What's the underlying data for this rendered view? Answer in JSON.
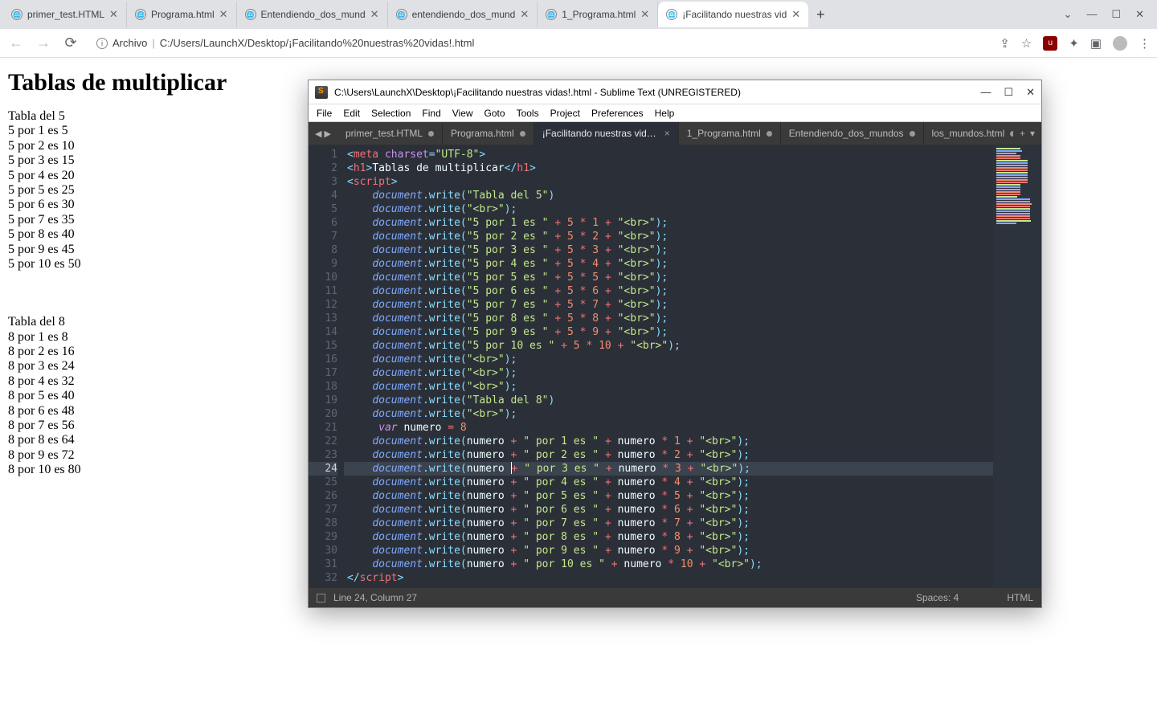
{
  "browser": {
    "tabs": [
      {
        "label": "primer_test.HTML"
      },
      {
        "label": "Programa.html"
      },
      {
        "label": "Entendiendo_dos_mund"
      },
      {
        "label": "entendiendo_dos_mund"
      },
      {
        "label": "1_Programa.html"
      },
      {
        "label": "¡Facilitando nuestras vid"
      }
    ],
    "active_tab": 5,
    "url_prefix": "Archivo",
    "url": "C:/Users/LaunchX/Desktop/¡Facilitando%20nuestras%20vidas!.html"
  },
  "page": {
    "h1": "Tablas de multiplicar",
    "block1_title": "Tabla del 5",
    "block1": [
      "5 por 1 es 5",
      "5 por 2 es 10",
      "5 por 3 es 15",
      "5 por 4 es 20",
      "5 por 5 es 25",
      "5 por 6 es 30",
      "5 por 7 es 35",
      "5 por 8 es 40",
      "5 por 9 es 45",
      "5 por 10 es 50"
    ],
    "block2_title": "Tabla del 8",
    "block2": [
      "8 por 1 es 8",
      "8 por 2 es 16",
      "8 por 3 es 24",
      "8 por 4 es 32",
      "8 por 5 es 40",
      "8 por 6 es 48",
      "8 por 7 es 56",
      "8 por 8 es 64",
      "8 por 9 es 72",
      "8 por 10 es 80"
    ]
  },
  "sublime": {
    "title": "C:\\Users\\LaunchX\\Desktop\\¡Facilitando nuestras vidas!.html - Sublime Text (UNREGISTERED)",
    "menus": [
      "File",
      "Edit",
      "Selection",
      "Find",
      "View",
      "Goto",
      "Tools",
      "Project",
      "Preferences",
      "Help"
    ],
    "tabs": [
      {
        "label": "primer_test.HTML",
        "dirty": true
      },
      {
        "label": "Programa.html",
        "dirty": true
      },
      {
        "label": "¡Facilitando nuestras vidas!.html",
        "dirty": false,
        "active": true
      },
      {
        "label": "1_Programa.html",
        "dirty": true
      },
      {
        "label": "Entendiendo_dos_mundos",
        "dirty": true
      },
      {
        "label": "los_mundos.html",
        "dirty": true
      }
    ],
    "status_left": "Line 24, Column 27",
    "status_spaces": "Spaces: 4",
    "status_lang": "HTML",
    "highlight_line": 24,
    "code": [
      {
        "n": 1,
        "html": "<span class='c-punc'>&lt;</span><span class='c-tag'>meta</span> <span class='c-attr'>charset</span><span class='c-punc'>=</span><span class='c-str'>\"UTF-8\"</span><span class='c-punc'>&gt;</span>"
      },
      {
        "n": 2,
        "html": "<span class='c-punc'>&lt;</span><span class='c-tag'>h1</span><span class='c-punc'>&gt;</span><span class='c-text'>Tablas de multiplicar</span><span class='c-punc'>&lt;/</span><span class='c-tag'>h1</span><span class='c-punc'>&gt;</span>"
      },
      {
        "n": 3,
        "html": "<span class='c-punc'>&lt;</span><span class='c-tag'>script</span><span class='c-punc'>&gt;</span>"
      },
      {
        "n": 4,
        "html": "    <span class='c-obj'>document</span><span class='c-punc'>.</span><span class='c-func'>write</span><span class='c-punc'>(</span><span class='c-str'>\"Tabla del 5\"</span><span class='c-punc'>)</span>"
      },
      {
        "n": 5,
        "html": "    <span class='c-obj'>document</span><span class='c-punc'>.</span><span class='c-func'>write</span><span class='c-punc'>(</span><span class='c-str'>\"&lt;br&gt;\"</span><span class='c-punc'>);</span>"
      },
      {
        "n": 6,
        "html": "    <span class='c-obj'>document</span><span class='c-punc'>.</span><span class='c-func'>write</span><span class='c-punc'>(</span><span class='c-str'>\"5 por 1 es \"</span> <span class='c-op'>+</span> <span class='c-num'>5</span> <span class='c-op'>*</span> <span class='c-num'>1</span> <span class='c-op'>+</span> <span class='c-str'>\"&lt;br&gt;\"</span><span class='c-punc'>);</span>"
      },
      {
        "n": 7,
        "html": "    <span class='c-obj'>document</span><span class='c-punc'>.</span><span class='c-func'>write</span><span class='c-punc'>(</span><span class='c-str'>\"5 por 2 es \"</span> <span class='c-op'>+</span> <span class='c-num'>5</span> <span class='c-op'>*</span> <span class='c-num'>2</span> <span class='c-op'>+</span> <span class='c-str'>\"&lt;br&gt;\"</span><span class='c-punc'>);</span>"
      },
      {
        "n": 8,
        "html": "    <span class='c-obj'>document</span><span class='c-punc'>.</span><span class='c-func'>write</span><span class='c-punc'>(</span><span class='c-str'>\"5 por 3 es \"</span> <span class='c-op'>+</span> <span class='c-num'>5</span> <span class='c-op'>*</span> <span class='c-num'>3</span> <span class='c-op'>+</span> <span class='c-str'>\"&lt;br&gt;\"</span><span class='c-punc'>);</span>"
      },
      {
        "n": 9,
        "html": "    <span class='c-obj'>document</span><span class='c-punc'>.</span><span class='c-func'>write</span><span class='c-punc'>(</span><span class='c-str'>\"5 por 4 es \"</span> <span class='c-op'>+</span> <span class='c-num'>5</span> <span class='c-op'>*</span> <span class='c-num'>4</span> <span class='c-op'>+</span> <span class='c-str'>\"&lt;br&gt;\"</span><span class='c-punc'>);</span>"
      },
      {
        "n": 10,
        "html": "    <span class='c-obj'>document</span><span class='c-punc'>.</span><span class='c-func'>write</span><span class='c-punc'>(</span><span class='c-str'>\"5 por 5 es \"</span> <span class='c-op'>+</span> <span class='c-num'>5</span> <span class='c-op'>*</span> <span class='c-num'>5</span> <span class='c-op'>+</span> <span class='c-str'>\"&lt;br&gt;\"</span><span class='c-punc'>);</span>"
      },
      {
        "n": 11,
        "html": "    <span class='c-obj'>document</span><span class='c-punc'>.</span><span class='c-func'>write</span><span class='c-punc'>(</span><span class='c-str'>\"5 por 6 es \"</span> <span class='c-op'>+</span> <span class='c-num'>5</span> <span class='c-op'>*</span> <span class='c-num'>6</span> <span class='c-op'>+</span> <span class='c-str'>\"&lt;br&gt;\"</span><span class='c-punc'>);</span>"
      },
      {
        "n": 12,
        "html": "    <span class='c-obj'>document</span><span class='c-punc'>.</span><span class='c-func'>write</span><span class='c-punc'>(</span><span class='c-str'>\"5 por 7 es \"</span> <span class='c-op'>+</span> <span class='c-num'>5</span> <span class='c-op'>*</span> <span class='c-num'>7</span> <span class='c-op'>+</span> <span class='c-str'>\"&lt;br&gt;\"</span><span class='c-punc'>);</span>"
      },
      {
        "n": 13,
        "html": "    <span class='c-obj'>document</span><span class='c-punc'>.</span><span class='c-func'>write</span><span class='c-punc'>(</span><span class='c-str'>\"5 por 8 es \"</span> <span class='c-op'>+</span> <span class='c-num'>5</span> <span class='c-op'>*</span> <span class='c-num'>8</span> <span class='c-op'>+</span> <span class='c-str'>\"&lt;br&gt;\"</span><span class='c-punc'>);</span>"
      },
      {
        "n": 14,
        "html": "    <span class='c-obj'>document</span><span class='c-punc'>.</span><span class='c-func'>write</span><span class='c-punc'>(</span><span class='c-str'>\"5 por 9 es \"</span> <span class='c-op'>+</span> <span class='c-num'>5</span> <span class='c-op'>*</span> <span class='c-num'>9</span> <span class='c-op'>+</span> <span class='c-str'>\"&lt;br&gt;\"</span><span class='c-punc'>);</span>"
      },
      {
        "n": 15,
        "html": "    <span class='c-obj'>document</span><span class='c-punc'>.</span><span class='c-func'>write</span><span class='c-punc'>(</span><span class='c-str'>\"5 por 10 es \"</span> <span class='c-op'>+</span> <span class='c-num'>5</span> <span class='c-op'>*</span> <span class='c-num'>10</span> <span class='c-op'>+</span> <span class='c-str'>\"&lt;br&gt;\"</span><span class='c-punc'>);</span>"
      },
      {
        "n": 16,
        "html": "    <span class='c-obj'>document</span><span class='c-punc'>.</span><span class='c-func'>write</span><span class='c-punc'>(</span><span class='c-str'>\"&lt;br&gt;\"</span><span class='c-punc'>);</span>"
      },
      {
        "n": 17,
        "html": "    <span class='c-obj'>document</span><span class='c-punc'>.</span><span class='c-func'>write</span><span class='c-punc'>(</span><span class='c-str'>\"&lt;br&gt;\"</span><span class='c-punc'>);</span>"
      },
      {
        "n": 18,
        "html": "    <span class='c-obj'>document</span><span class='c-punc'>.</span><span class='c-func'>write</span><span class='c-punc'>(</span><span class='c-str'>\"&lt;br&gt;\"</span><span class='c-punc'>);</span>"
      },
      {
        "n": 19,
        "html": "    <span class='c-obj'>document</span><span class='c-punc'>.</span><span class='c-func'>write</span><span class='c-punc'>(</span><span class='c-str'>\"Tabla del 8\"</span><span class='c-punc'>)</span>"
      },
      {
        "n": 20,
        "html": "    <span class='c-obj'>document</span><span class='c-punc'>.</span><span class='c-func'>write</span><span class='c-punc'>(</span><span class='c-str'>\"&lt;br&gt;\"</span><span class='c-punc'>);</span>"
      },
      {
        "n": 21,
        "html": "     <span class='c-kwd'>var</span> <span class='c-var'>numero</span> <span class='c-op'>=</span> <span class='c-num'>8</span>"
      },
      {
        "n": 22,
        "html": "    <span class='c-obj'>document</span><span class='c-punc'>.</span><span class='c-func'>write</span><span class='c-punc'>(</span><span class='c-var'>numero</span> <span class='c-op'>+</span> <span class='c-str'>\" por 1 es \"</span> <span class='c-op'>+</span> <span class='c-var'>numero</span> <span class='c-op'>*</span> <span class='c-num'>1</span> <span class='c-op'>+</span> <span class='c-str'>\"&lt;br&gt;\"</span><span class='c-punc'>);</span>"
      },
      {
        "n": 23,
        "html": "    <span class='c-obj'>document</span><span class='c-punc'>.</span><span class='c-func'>write</span><span class='c-punc'>(</span><span class='c-var'>numero</span> <span class='c-op'>+</span> <span class='c-str'>\" por 2 es \"</span> <span class='c-op'>+</span> <span class='c-var'>numero</span> <span class='c-op'>*</span> <span class='c-num'>2</span> <span class='c-op'>+</span> <span class='c-str'>\"&lt;br&gt;\"</span><span class='c-punc'>);</span>"
      },
      {
        "n": 24,
        "html": "    <span class='c-obj'>document</span><span class='c-punc'>.</span><span class='c-func'>write</span><span class='c-punc'>(</span><span class='c-var'>numero</span> <span class='c-op'><span class='cursor'></span>+</span> <span class='c-str'>\" por 3 es \"</span> <span class='c-op'>+</span> <span class='c-var'>numero</span> <span class='c-op'>*</span> <span class='c-num'>3</span> <span class='c-op'>+</span> <span class='c-str'>\"&lt;br&gt;\"</span><span class='c-punc'>);</span>"
      },
      {
        "n": 25,
        "html": "    <span class='c-obj'>document</span><span class='c-punc'>.</span><span class='c-func'>write</span><span class='c-punc'>(</span><span class='c-var'>numero</span> <span class='c-op'>+</span> <span class='c-str'>\" por 4 es \"</span> <span class='c-op'>+</span> <span class='c-var'>numero</span> <span class='c-op'>*</span> <span class='c-num'>4</span> <span class='c-op'>+</span> <span class='c-str'>\"&lt;br&gt;\"</span><span class='c-punc'>);</span>"
      },
      {
        "n": 26,
        "html": "    <span class='c-obj'>document</span><span class='c-punc'>.</span><span class='c-func'>write</span><span class='c-punc'>(</span><span class='c-var'>numero</span> <span class='c-op'>+</span> <span class='c-str'>\" por 5 es \"</span> <span class='c-op'>+</span> <span class='c-var'>numero</span> <span class='c-op'>*</span> <span class='c-num'>5</span> <span class='c-op'>+</span> <span class='c-str'>\"&lt;br&gt;\"</span><span class='c-punc'>);</span>"
      },
      {
        "n": 27,
        "html": "    <span class='c-obj'>document</span><span class='c-punc'>.</span><span class='c-func'>write</span><span class='c-punc'>(</span><span class='c-var'>numero</span> <span class='c-op'>+</span> <span class='c-str'>\" por 6 es \"</span> <span class='c-op'>+</span> <span class='c-var'>numero</span> <span class='c-op'>*</span> <span class='c-num'>6</span> <span class='c-op'>+</span> <span class='c-str'>\"&lt;br&gt;\"</span><span class='c-punc'>);</span>"
      },
      {
        "n": 28,
        "html": "    <span class='c-obj'>document</span><span class='c-punc'>.</span><span class='c-func'>write</span><span class='c-punc'>(</span><span class='c-var'>numero</span> <span class='c-op'>+</span> <span class='c-str'>\" por 7 es \"</span> <span class='c-op'>+</span> <span class='c-var'>numero</span> <span class='c-op'>*</span> <span class='c-num'>7</span> <span class='c-op'>+</span> <span class='c-str'>\"&lt;br&gt;\"</span><span class='c-punc'>);</span>"
      },
      {
        "n": 29,
        "html": "    <span class='c-obj'>document</span><span class='c-punc'>.</span><span class='c-func'>write</span><span class='c-punc'>(</span><span class='c-var'>numero</span> <span class='c-op'>+</span> <span class='c-str'>\" por 8 es \"</span> <span class='c-op'>+</span> <span class='c-var'>numero</span> <span class='c-op'>*</span> <span class='c-num'>8</span> <span class='c-op'>+</span> <span class='c-str'>\"&lt;br&gt;\"</span><span class='c-punc'>);</span>"
      },
      {
        "n": 30,
        "html": "    <span class='c-obj'>document</span><span class='c-punc'>.</span><span class='c-func'>write</span><span class='c-punc'>(</span><span class='c-var'>numero</span> <span class='c-op'>+</span> <span class='c-str'>\" por 9 es \"</span> <span class='c-op'>+</span> <span class='c-var'>numero</span> <span class='c-op'>*</span> <span class='c-num'>9</span> <span class='c-op'>+</span> <span class='c-str'>\"&lt;br&gt;\"</span><span class='c-punc'>);</span>"
      },
      {
        "n": 31,
        "html": "    <span class='c-obj'>document</span><span class='c-punc'>.</span><span class='c-func'>write</span><span class='c-punc'>(</span><span class='c-var'>numero</span> <span class='c-op'>+</span> <span class='c-str'>\" por 10 es \"</span> <span class='c-op'>+</span> <span class='c-var'>numero</span> <span class='c-op'>*</span> <span class='c-num'>10</span> <span class='c-op'>+</span> <span class='c-str'>\"&lt;br&gt;\"</span><span class='c-punc'>);</span>"
      },
      {
        "n": 32,
        "html": "<span class='c-punc'>&lt;/</span><span class='c-tag'>script</span><span class='c-punc'>&gt;</span>"
      }
    ]
  }
}
